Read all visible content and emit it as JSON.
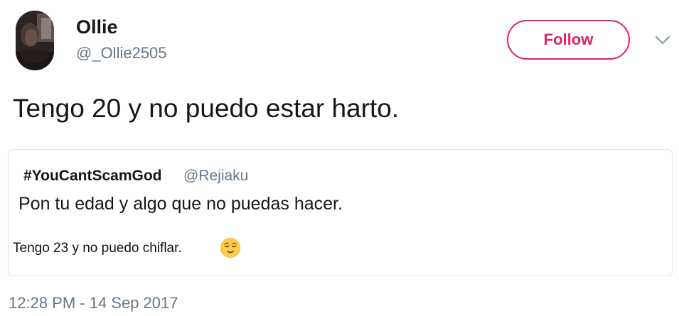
{
  "author": {
    "display_name": "Ollie",
    "handle": "@_Ollie2505"
  },
  "header": {
    "follow_label": "Follow",
    "more_icon": "chevron-down-icon"
  },
  "tweet": {
    "text": "Tengo 20 y no puedo estar harto.",
    "timestamp": "12:28 PM - 14 Sep 2017"
  },
  "quoted_tweet": {
    "author": "#YouCantScamGod",
    "handle": "@Rejiaku",
    "text": "Pon tu edad y algo que no puedas hacer.",
    "image_text": "Tengo 23 y no puedo chiflar.",
    "emoji": "relieved-face-emoji"
  },
  "colors": {
    "accent": "#e0245e",
    "secondary_text": "#657786",
    "primary_text": "#14171a",
    "border": "#dfe3e7"
  }
}
